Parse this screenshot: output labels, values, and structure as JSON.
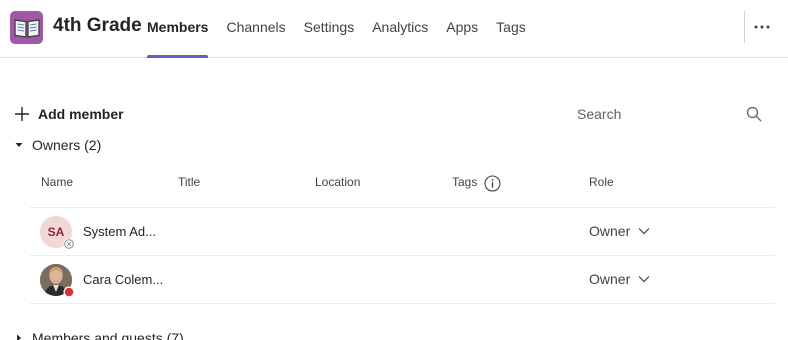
{
  "header": {
    "team_name": "4th Grade",
    "tabs": [
      {
        "label": "Members"
      },
      {
        "label": "Channels"
      },
      {
        "label": "Settings"
      },
      {
        "label": "Analytics"
      },
      {
        "label": "Apps"
      },
      {
        "label": "Tags"
      }
    ],
    "active_tab": "Members",
    "more_icon": "more-horizontal-icon",
    "team_icon": "book-icon"
  },
  "toolbar": {
    "add_member_label": "Add member",
    "search_placeholder": "Search"
  },
  "owners": {
    "section_label": "Owners (2)",
    "columns": {
      "name": "Name",
      "title": "Title",
      "location": "Location",
      "tags": "Tags",
      "role": "Role"
    },
    "rows": [
      {
        "initials": "SA",
        "name": "System Ad...",
        "role": "Owner",
        "presence": "offline"
      },
      {
        "initials": "",
        "name": "Cara Colem...",
        "role": "Owner",
        "presence": "busy"
      }
    ]
  },
  "members": {
    "section_label": "Members and guests (7)"
  },
  "colors": {
    "accent": "#5b5fc7",
    "team_avatar": "#a058a8",
    "busy": "#d13438"
  }
}
